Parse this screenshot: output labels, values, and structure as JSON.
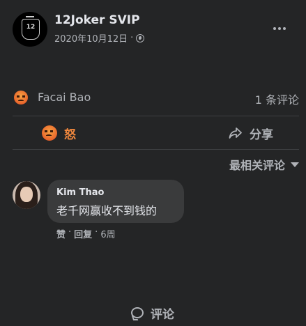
{
  "post": {
    "author": "12Joker SVIP",
    "avatar_text": "12",
    "date": "2020年10月12日",
    "separator": "·",
    "privacy_icon": "globe-icon",
    "more_icon": "more-horizontal-icon"
  },
  "reactions": {
    "reaction_icon": "angry-emoji-icon",
    "reactor": "Facai Bao",
    "comment_count": "1 条评论"
  },
  "actions": {
    "angry_label": "怒",
    "comment_label": "评论",
    "share_label": "分享"
  },
  "sort": {
    "label": "最相关评论"
  },
  "comment": {
    "name": "Kim Thao",
    "text": "老千网赢收不到钱的",
    "like_label": "赞",
    "reply_label": "回复",
    "time": "6周",
    "separator": "·"
  },
  "colors": {
    "background": "#242526",
    "bubble": "#3a3b3c",
    "angry_accent": "#f3893e",
    "secondary_text": "#b0b3b8"
  }
}
